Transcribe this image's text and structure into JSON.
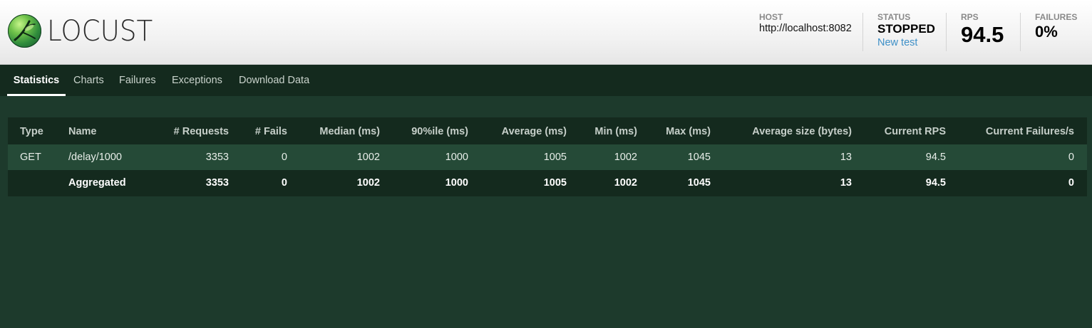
{
  "app": {
    "logo_text": "LOCUST"
  },
  "stats": {
    "host": {
      "label": "HOST",
      "value": "http://localhost:8082"
    },
    "status": {
      "label": "STATUS",
      "value": "STOPPED",
      "link": "New test"
    },
    "rps": {
      "label": "RPS",
      "value": "94.5"
    },
    "failures": {
      "label": "FAILURES",
      "value": "0%"
    }
  },
  "tabs": [
    {
      "label": "Statistics",
      "active": true
    },
    {
      "label": "Charts",
      "active": false
    },
    {
      "label": "Failures",
      "active": false
    },
    {
      "label": "Exceptions",
      "active": false
    },
    {
      "label": "Download Data",
      "active": false
    }
  ],
  "table": {
    "columns": [
      "Type",
      "Name",
      "# Requests",
      "# Fails",
      "Median (ms)",
      "90%ile (ms)",
      "Average (ms)",
      "Min (ms)",
      "Max (ms)",
      "Average size (bytes)",
      "Current RPS",
      "Current Failures/s"
    ],
    "rows": [
      [
        "GET",
        "/delay/1000",
        "3353",
        "0",
        "1002",
        "1000",
        "1005",
        "1002",
        "1045",
        "13",
        "94.5",
        "0"
      ]
    ],
    "aggregate": [
      "",
      "Aggregated",
      "3353",
      "0",
      "1002",
      "1000",
      "1005",
      "1002",
      "1045",
      "13",
      "94.5",
      "0"
    ]
  },
  "colors": {
    "background": "#1d3a2c",
    "tab_bar": "#142a1e",
    "row_highlight": "#254a37",
    "link": "#3d8fc7"
  }
}
